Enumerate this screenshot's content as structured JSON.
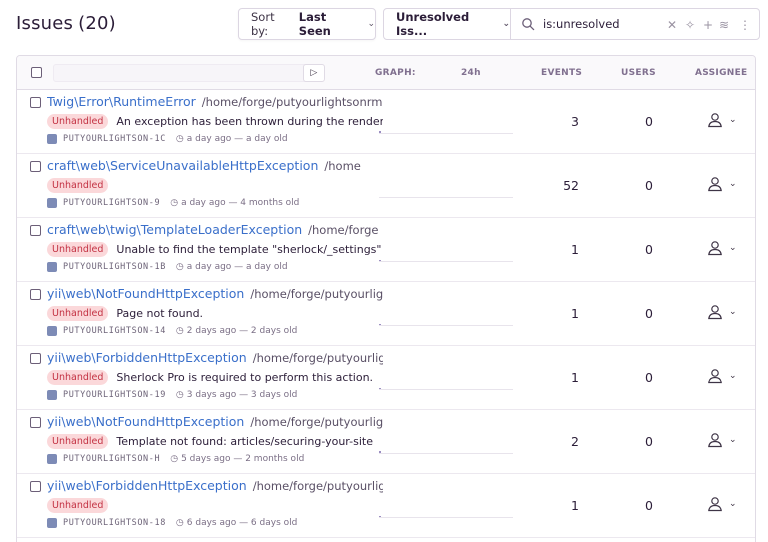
{
  "header": {
    "title": "Issues",
    "count": "(20)",
    "sort_label": "Sort by:",
    "sort_value": "Last Seen",
    "saved_query": "Unresolved Iss...",
    "search_value": "is:unresolved"
  },
  "table": {
    "col_graph": "GRAPH:",
    "col_period": "24h",
    "col_events": "EVENTS",
    "col_users": "USERS",
    "col_assignee": "ASSIGNEE"
  },
  "issues": [
    {
      "title": "Twig\\Error\\RuntimeError",
      "path": "/home/forge/putyourlightsonrmc",
      "badge": "Unhandled",
      "message": "An exception has been thrown during the rendering of a template",
      "project": "PUTYOURLIGHTSON-1C",
      "seen": "a day ago — a day old",
      "events": "3",
      "users": "0",
      "spike": 0.2
    },
    {
      "title": "craft\\web\\ServiceUnavailableHttpException",
      "path": "/home",
      "badge": "Unhandled",
      "message": "",
      "project": "PUTYOURLIGHTSON-9",
      "seen": "a day ago — 4 months old",
      "events": "52",
      "users": "0",
      "spike": 0
    },
    {
      "title": "craft\\web\\twig\\TemplateLoaderException",
      "path": "/home/forge",
      "badge": "Unhandled",
      "message": "Unable to find the template \"sherlock/_settings\"",
      "project": "PUTYOURLIGHTSON-1B",
      "seen": "a day ago — a day old",
      "events": "1",
      "users": "0",
      "spike": 0.1
    },
    {
      "title": "yii\\web\\NotFoundHttpException",
      "path": "/home/forge/putyourlights",
      "badge": "Unhandled",
      "message": "Page not found.",
      "project": "PUTYOURLIGHTSON-14",
      "seen": "2 days ago — 2 days old",
      "events": "1",
      "users": "0",
      "spike": 0.1
    },
    {
      "title": "yii\\web\\ForbiddenHttpException",
      "path": "/home/forge/putyourlights",
      "badge": "Unhandled",
      "message": "Sherlock Pro is required to perform this action.",
      "project": "PUTYOURLIGHTSON-19",
      "seen": "3 days ago — 3 days old",
      "events": "1",
      "users": "0",
      "spike": 0.1
    },
    {
      "title": "yii\\web\\NotFoundHttpException",
      "path": "/home/forge/putyourlights",
      "badge": "Unhandled",
      "message": "Template not found: articles/securing-your-site",
      "project": "PUTYOURLIGHTSON-H",
      "seen": "5 days ago — 2 months old",
      "events": "2",
      "users": "0",
      "spike": 0.15
    },
    {
      "title": "yii\\web\\ForbiddenHttpException",
      "path": "/home/forge/putyourlights",
      "badge": "Unhandled",
      "message": "",
      "project": "PUTYOURLIGHTSON-18",
      "seen": "6 days ago — 6 days old",
      "events": "1",
      "users": "0",
      "spike": 0.1
    }
  ]
}
